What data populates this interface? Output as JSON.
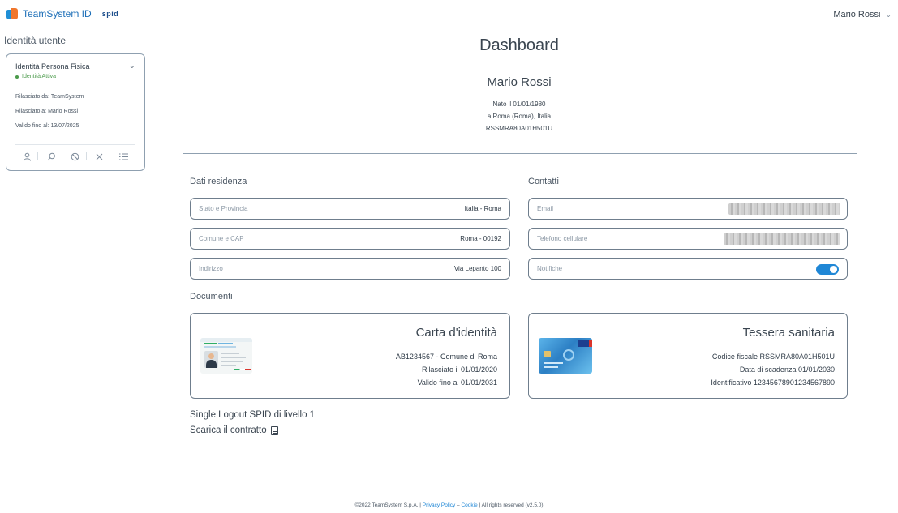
{
  "header": {
    "brand_name": "TeamSystem ID",
    "brand_spid": "spid",
    "user_name": "Mario Rossi",
    "user_menu_icon": "chevron-down-icon"
  },
  "sidebar": {
    "title": "Identità utente",
    "card": {
      "title": "Identità Persona Fisica",
      "status": "Identità Attiva",
      "status_color": "#4a9a4a",
      "issued_by": "Rilasciato da: TeamSystem",
      "issued_to": "Rilasciato a: Mario Rossi",
      "valid_until": "Valido fino al: 13/07/2025",
      "actions": [
        "user-icon",
        "search-icon",
        "block-icon",
        "close-icon",
        "list-icon"
      ]
    }
  },
  "main": {
    "title": "Dashboard",
    "person": {
      "name": "Mario Rossi",
      "birth_date": "Nato il 01/01/1980",
      "birth_place": "a Roma (Roma), Italia",
      "tax_code": "RSSMRA80A01H501U"
    },
    "residence": {
      "title": "Dati residenza",
      "state_label": "Stato e Provincia",
      "state_value": "Italia - Roma",
      "city_label": "Comune e CAP",
      "city_value": "Roma - 00192",
      "address_label": "Indirizzo",
      "address_value": "Via Lepanto 100"
    },
    "contacts": {
      "title": "Contatti",
      "email_label": "Email",
      "phone_label": "Telefono cellulare",
      "notifications_label": "Notifiche",
      "notifications_on": true,
      "accent_color": "#1f87d6"
    },
    "documents": {
      "title": "Documenti",
      "id_card": {
        "title": "Carta d'identità",
        "number": "AB1234567 - Comune di Roma",
        "issued": "Rilasciato il 01/01/2020",
        "valid": "Valido fino al 01/01/2031"
      },
      "health_card": {
        "title": "Tessera sanitaria",
        "tax_code": "Codice fiscale RSSMRA80A01H501U",
        "expiry": "Data di scadenza 01/01/2030",
        "identifier": "Identificativo 12345678901234567890"
      }
    },
    "links": {
      "logout": "Single Logout SPID di livello 1",
      "contract": "Scarica il contratto"
    }
  },
  "footer": {
    "copyright": "©2022 TeamSystem S.p.A. | ",
    "privacy": "Privacy Policy",
    "dash": " – ",
    "cookie": "Cookie",
    "rights": " | All rights reserved (v2.5.0)"
  }
}
